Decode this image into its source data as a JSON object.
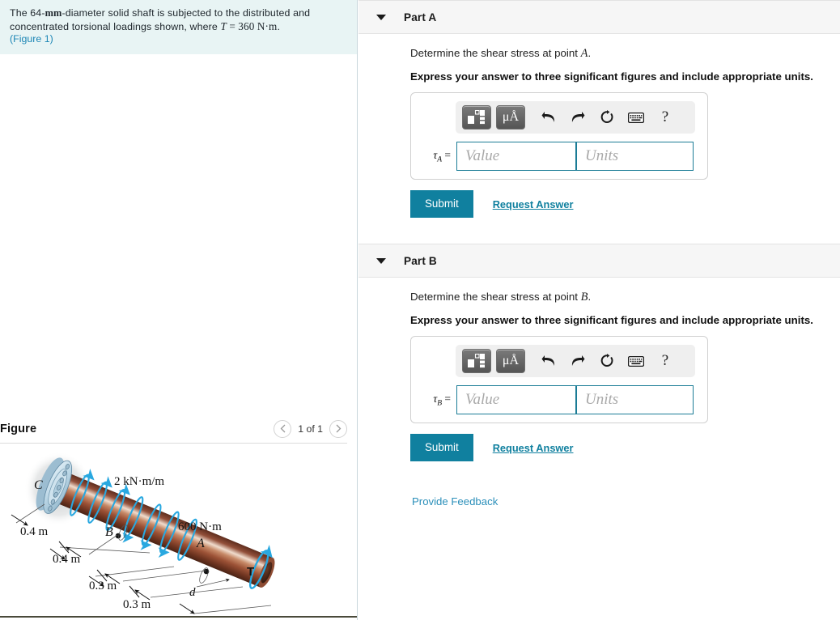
{
  "question": {
    "text_part1": "The 64-",
    "text_mm": "mm",
    "text_part2": "-diameter solid shaft is subjected to the distributed and concentrated torsional loadings shown, where ",
    "formula": "T = 360 N·m",
    "period": ".",
    "figure_link": "(Figure 1)"
  },
  "figure": {
    "title": "Figure",
    "pager": {
      "prev_icon": "chevron-left-icon",
      "next_icon": "chevron-right-icon",
      "count_label": "1 of 1"
    },
    "labels": {
      "point_c": "C",
      "point_b": "B",
      "point_a": "A",
      "distributed_torque": "2 kN·m/m",
      "concentrated_torque": "600 N·m",
      "end_torque": "T",
      "diameter": "d",
      "dim1": "0.4 m",
      "dim2": "0.4 m",
      "dim3": "0.3 m",
      "dim4": "0.3 m"
    },
    "colors": {
      "shaft_dark": "#5b2b1c",
      "shaft_mid": "#a8613f",
      "shaft_light": "#e8d3c4",
      "arrow_blue": "#29a8e0",
      "flange_blue": "#c3dbe8"
    }
  },
  "parts": [
    {
      "id": "A",
      "header": "Part A",
      "caret_icon": "caret-down-icon",
      "question": "Determine the shear stress at point A.",
      "question_prefix": "Determine the shear stress at point ",
      "question_symbol": "A",
      "instruction": "Express your answer to three significant figures and include appropriate units.",
      "tau_symbol": "τ",
      "tau_subscript": "A",
      "equals": "=",
      "value_placeholder": "Value",
      "units_placeholder": "Units",
      "value": "",
      "units": "",
      "submit_label": "Submit",
      "request_label": "Request Answer",
      "toolbar": {
        "template_icon": "math-template-icon",
        "units_icon": "micro-angstrom-units-icon",
        "undo_icon": "undo-arrow-icon",
        "redo_icon": "redo-arrow-icon",
        "reset_icon": "reset-circular-arrow-icon",
        "keyboard_icon": "keyboard-icon",
        "help_icon": "question-mark-icon",
        "units_label": "μÅ",
        "help_label": "?"
      }
    },
    {
      "id": "B",
      "header": "Part B",
      "caret_icon": "caret-down-icon",
      "question": "Determine the shear stress at point B.",
      "question_prefix": "Determine the shear stress at point ",
      "question_symbol": "B",
      "instruction": "Express your answer to three significant figures and include appropriate units.",
      "tau_symbol": "τ",
      "tau_subscript": "B",
      "equals": "=",
      "value_placeholder": "Value",
      "units_placeholder": "Units",
      "value": "",
      "units": "",
      "submit_label": "Submit",
      "request_label": "Request Answer",
      "toolbar": {
        "template_icon": "math-template-icon",
        "units_icon": "micro-angstrom-units-icon",
        "undo_icon": "undo-arrow-icon",
        "redo_icon": "redo-arrow-icon",
        "reset_icon": "reset-circular-arrow-icon",
        "keyboard_icon": "keyboard-icon",
        "help_icon": "question-mark-icon",
        "units_label": "μÅ",
        "help_label": "?"
      }
    }
  ],
  "footer": {
    "provide_feedback": "Provide Feedback"
  },
  "colors": {
    "accent_teal": "#10809f",
    "link_blue": "#2b8fba",
    "prompt_bg": "#e8f4f4",
    "header_bg": "#f6f6f6",
    "input_border": "#1b7c96"
  }
}
